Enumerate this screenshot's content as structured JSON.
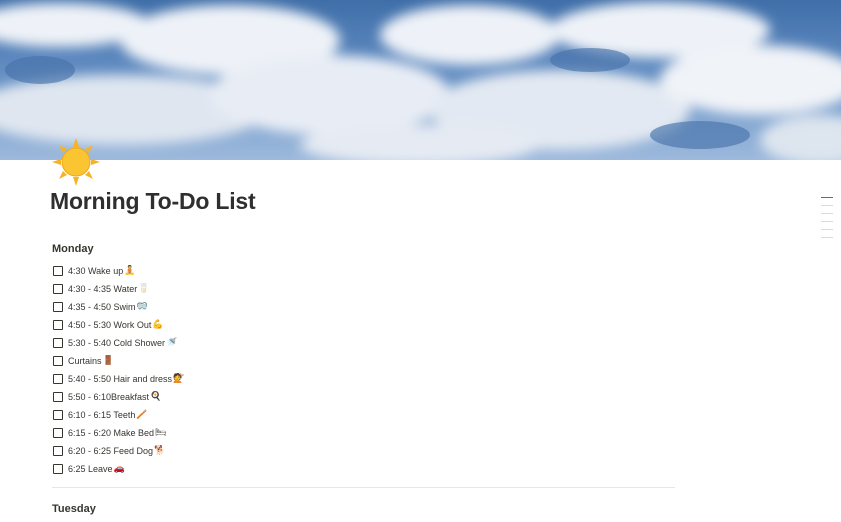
{
  "page": {
    "title": "Morning To-Do List",
    "icon": "sun-icon"
  },
  "cover": {
    "description_colors": {
      "sky": "#4a78b0",
      "cloud": "#f2f4f8"
    }
  },
  "sections": [
    {
      "heading": "Monday",
      "todos": [
        {
          "text": "4:30 Wake up",
          "emoji": "🧘",
          "checked": false
        },
        {
          "text": "4:30 - 4:35 Water",
          "emoji": "🥛",
          "checked": false
        },
        {
          "text": "4:35 - 4:50 Swim",
          "emoji": "🥽",
          "checked": false
        },
        {
          "text": "4:50 - 5:30 Work Out",
          "emoji": "💪",
          "checked": false
        },
        {
          "text": "5:30 - 5:40 Cold Shower",
          "emoji": "🚿",
          "checked": false
        },
        {
          "text": "Curtains",
          "emoji": "🚪",
          "checked": false
        },
        {
          "text": "5:40 - 5:50 Hair and dress",
          "emoji": "💇",
          "checked": false
        },
        {
          "text": "5:50 - 6:10Breakfast",
          "emoji": "🍳",
          "checked": false
        },
        {
          "text": "6:10 - 6:15 Teeth",
          "emoji": "🪥",
          "checked": false
        },
        {
          "text": "6:15 - 6:20 Make Bed",
          "emoji": "🛏",
          "checked": false
        },
        {
          "text": "6:20 - 6:25 Feed Dog",
          "emoji": "🐕",
          "checked": false
        },
        {
          "text": "6:25 Leave",
          "emoji": "🚗",
          "checked": false
        }
      ]
    },
    {
      "heading": "Tuesday",
      "todos": []
    }
  ]
}
